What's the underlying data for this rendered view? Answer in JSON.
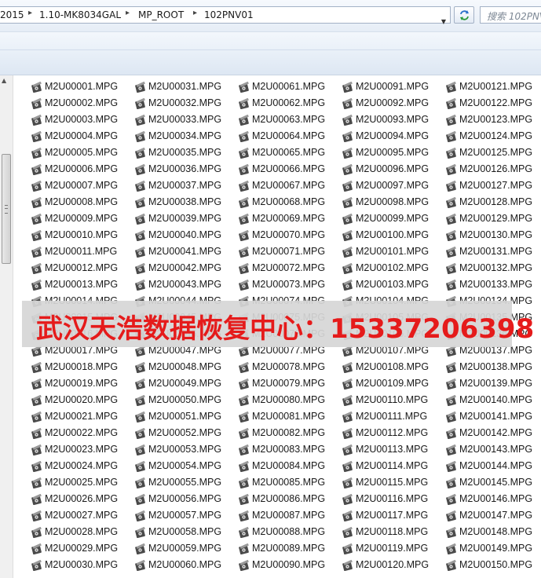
{
  "address_bar": {
    "crumbs": [
      "2015",
      "1.10-MK8034GAL",
      "MP_ROOT",
      "102PNV01"
    ],
    "search_placeholder": "搜索 102PNV01"
  },
  "watermark": {
    "text": "武汉天浩数据恢复中心：15337206398"
  },
  "files": {
    "extension": ".MPG",
    "columns": [
      [
        "M2U00001.MPG",
        "M2U00002.MPG",
        "M2U00003.MPG",
        "M2U00004.MPG",
        "M2U00005.MPG",
        "M2U00006.MPG",
        "M2U00007.MPG",
        "M2U00008.MPG",
        "M2U00009.MPG",
        "M2U00010.MPG",
        "M2U00011.MPG",
        "M2U00012.MPG",
        "M2U00013.MPG",
        "M2U00014.MPG",
        "M2U00015.MPG",
        "M2U00016.MPG",
        "M2U00017.MPG",
        "M2U00018.MPG",
        "M2U00019.MPG",
        "M2U00020.MPG",
        "M2U00021.MPG",
        "M2U00022.MPG",
        "M2U00023.MPG",
        "M2U00024.MPG",
        "M2U00025.MPG",
        "M2U00026.MPG",
        "M2U00027.MPG",
        "M2U00028.MPG",
        "M2U00029.MPG",
        "M2U00030.MPG"
      ],
      [
        "M2U00031.MPG",
        "M2U00032.MPG",
        "M2U00033.MPG",
        "M2U00034.MPG",
        "M2U00035.MPG",
        "M2U00036.MPG",
        "M2U00037.MPG",
        "M2U00038.MPG",
        "M2U00039.MPG",
        "M2U00040.MPG",
        "M2U00041.MPG",
        "M2U00042.MPG",
        "M2U00043.MPG",
        "M2U00044.MPG",
        "M2U00045.MPG",
        "M2U00046.MPG",
        "M2U00047.MPG",
        "M2U00048.MPG",
        "M2U00049.MPG",
        "M2U00050.MPG",
        "M2U00051.MPG",
        "M2U00052.MPG",
        "M2U00053.MPG",
        "M2U00054.MPG",
        "M2U00055.MPG",
        "M2U00056.MPG",
        "M2U00057.MPG",
        "M2U00058.MPG",
        "M2U00059.MPG",
        "M2U00060.MPG"
      ],
      [
        "M2U00061.MPG",
        "M2U00062.MPG",
        "M2U00063.MPG",
        "M2U00064.MPG",
        "M2U00065.MPG",
        "M2U00066.MPG",
        "M2U00067.MPG",
        "M2U00068.MPG",
        "M2U00069.MPG",
        "M2U00070.MPG",
        "M2U00071.MPG",
        "M2U00072.MPG",
        "M2U00073.MPG",
        "M2U00074.MPG",
        "M2U00075.MPG",
        "M2U00076.MPG",
        "M2U00077.MPG",
        "M2U00078.MPG",
        "M2U00079.MPG",
        "M2U00080.MPG",
        "M2U00081.MPG",
        "M2U00082.MPG",
        "M2U00083.MPG",
        "M2U00084.MPG",
        "M2U00085.MPG",
        "M2U00086.MPG",
        "M2U00087.MPG",
        "M2U00088.MPG",
        "M2U00089.MPG",
        "M2U00090.MPG"
      ],
      [
        "M2U00091.MPG",
        "M2U00092.MPG",
        "M2U00093.MPG",
        "M2U00094.MPG",
        "M2U00095.MPG",
        "M2U00096.MPG",
        "M2U00097.MPG",
        "M2U00098.MPG",
        "M2U00099.MPG",
        "M2U00100.MPG",
        "M2U00101.MPG",
        "M2U00102.MPG",
        "M2U00103.MPG",
        "M2U00104.MPG",
        "M2U00105.MPG",
        "M2U00106.MPG",
        "M2U00107.MPG",
        "M2U00108.MPG",
        "M2U00109.MPG",
        "M2U00110.MPG",
        "M2U00111.MPG",
        "M2U00112.MPG",
        "M2U00113.MPG",
        "M2U00114.MPG",
        "M2U00115.MPG",
        "M2U00116.MPG",
        "M2U00117.MPG",
        "M2U00118.MPG",
        "M2U00119.MPG",
        "M2U00120.MPG"
      ],
      [
        "M2U00121.MPG",
        "M2U00122.MPG",
        "M2U00123.MPG",
        "M2U00124.MPG",
        "M2U00125.MPG",
        "M2U00126.MPG",
        "M2U00127.MPG",
        "M2U00128.MPG",
        "M2U00129.MPG",
        "M2U00130.MPG",
        "M2U00131.MPG",
        "M2U00132.MPG",
        "M2U00133.MPG",
        "M2U00134.MPG",
        "M2U00135.MPG",
        "M2U00136.MPG",
        "M2U00137.MPG",
        "M2U00138.MPG",
        "M2U00139.MPG",
        "M2U00140.MPG",
        "M2U00141.MPG",
        "M2U00142.MPG",
        "M2U00143.MPG",
        "M2U00144.MPG",
        "M2U00145.MPG",
        "M2U00146.MPG",
        "M2U00147.MPG",
        "M2U00148.MPG",
        "M2U00149.MPG",
        "M2U00150.MPG"
      ]
    ]
  },
  "icons": {
    "file": "media-file-icon",
    "refresh": "refresh-icon",
    "dropdown": "chevron-down-icon",
    "breadcrumb_separator": "chevron-right-icon"
  },
  "colors": {
    "watermark_text": "#e51b1b",
    "watermark_bg": "#d6d6d6"
  }
}
